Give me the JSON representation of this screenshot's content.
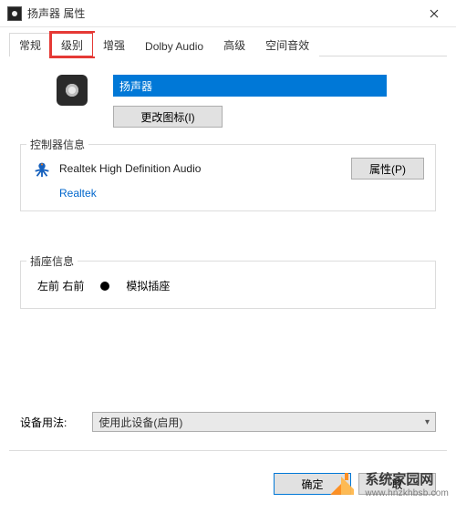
{
  "window": {
    "title": "扬声器 属性"
  },
  "tabs": [
    {
      "label": "常规"
    },
    {
      "label": "级别"
    },
    {
      "label": "增强"
    },
    {
      "label": "Dolby Audio"
    },
    {
      "label": "高级"
    },
    {
      "label": "空间音效"
    }
  ],
  "general": {
    "device_name": "扬声器",
    "change_icon_label": "更改图标(I)"
  },
  "controller": {
    "group_title": "控制器信息",
    "name": "Realtek High Definition Audio",
    "vendor": "Realtek",
    "properties_button": "属性(P)"
  },
  "jack": {
    "group_title": "插座信息",
    "position": "左前 右前",
    "type": "模拟插座"
  },
  "usage": {
    "label": "设备用法:",
    "value": "使用此设备(启用)"
  },
  "footer": {
    "ok": "确定",
    "cancel": "取"
  },
  "watermark": {
    "name": "系统家园网",
    "url": "www.hnzkhbsb.com"
  }
}
